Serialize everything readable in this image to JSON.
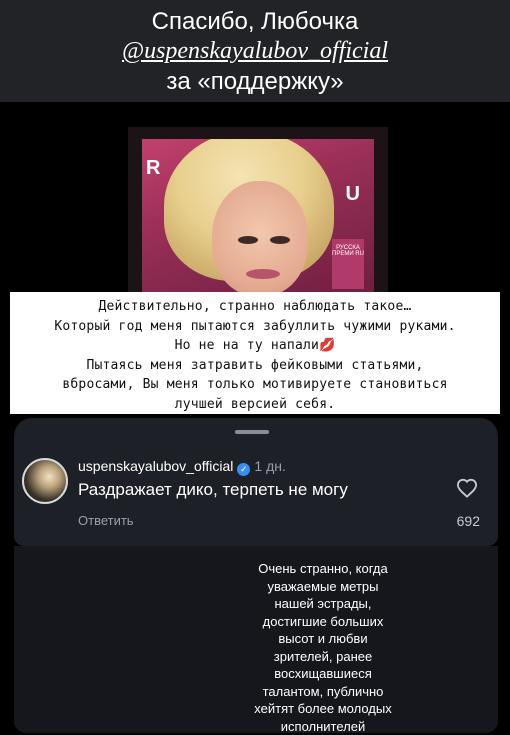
{
  "header": {
    "line1": "Спасибо, Любочка",
    "line2": "@uspenskayalubov_official",
    "line3": "за «поддержку»"
  },
  "photo": {
    "sign_left": "R",
    "sign_right": "U",
    "sign_box": "РУССКА ПРЕМИ RU"
  },
  "caption": {
    "lines": [
      "Действительно, странно наблюдать такое…",
      "Который год меня пытаются забуллить чужими руками.",
      "Но не на ту напали💋",
      "Пытаясь меня затравить фейковыми статьями,",
      "вбросами, Вы меня только мотивируете становиться",
      "лучшей версией себя."
    ]
  },
  "comment": {
    "username": "uspenskayalubov_official",
    "time": "1 дн.",
    "text": "Раздражает дико, терпеть не могу",
    "reply_label": "Ответить",
    "likes": "692",
    "icons": [
      "verified-icon",
      "heart-icon"
    ]
  },
  "overlay_text": {
    "lines": [
      "Очень странно, когда",
      "уважаемые метры",
      "нашей эстрады,",
      "достигшие больших",
      "высот и любви",
      "зрителей, ранее",
      "восхищавшиеся",
      "талантом, публично",
      "хейтят более молодых",
      "исполнителей"
    ]
  },
  "colors": {
    "header_bg": "#222326",
    "card_bg": "#1d2027",
    "verified_blue": "#3b8bf1",
    "muted_text": "#9aa0a8"
  }
}
